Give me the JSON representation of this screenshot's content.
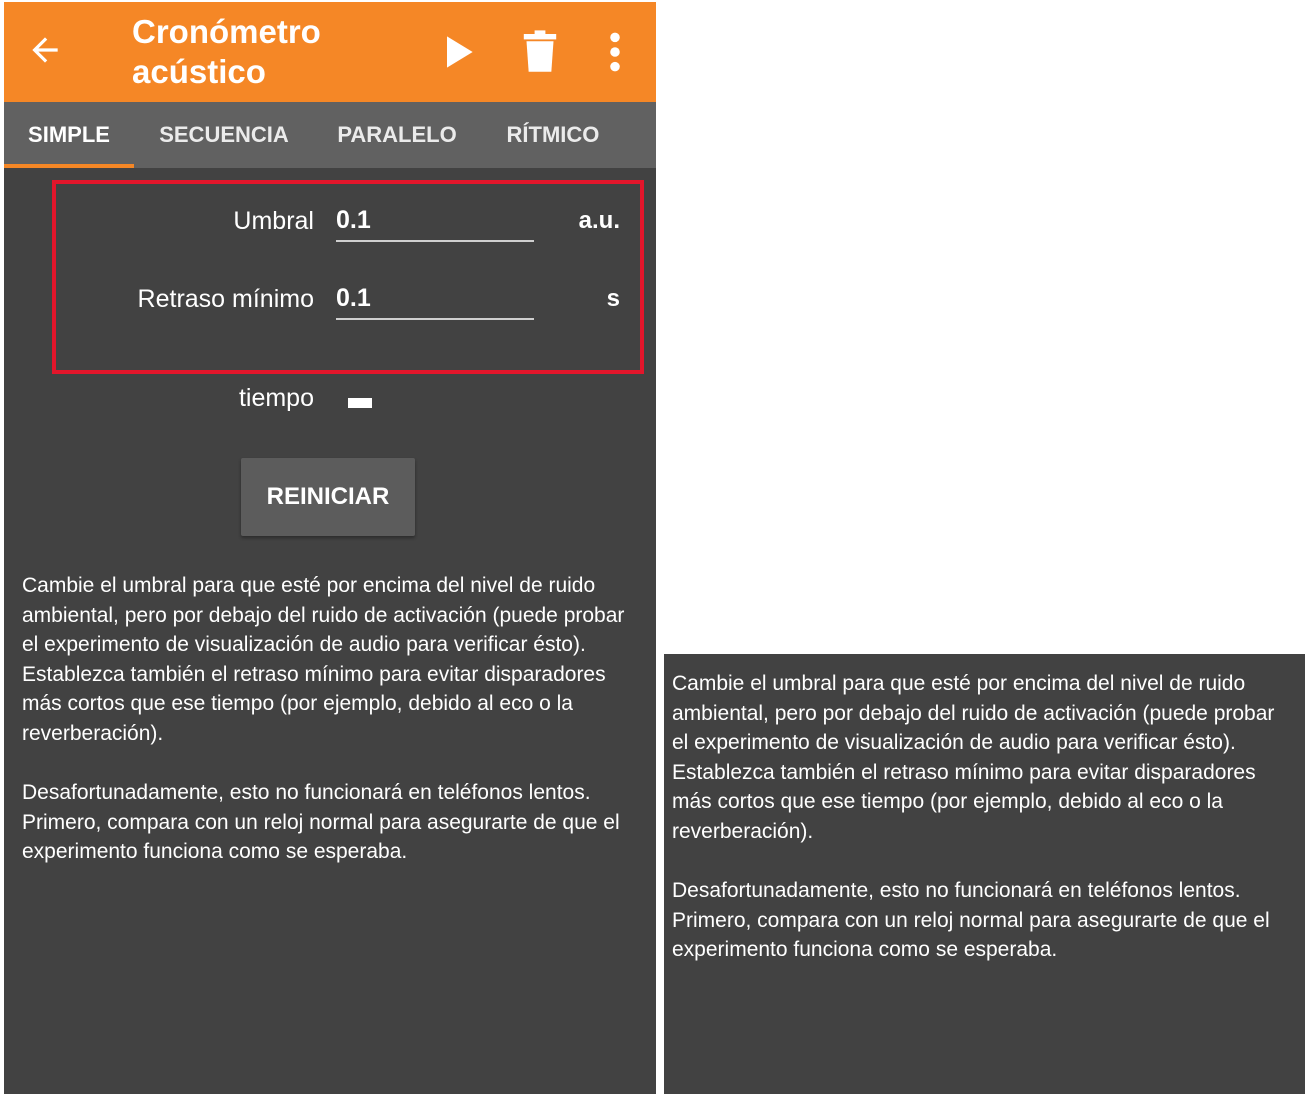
{
  "app_bar": {
    "title": "Cronómetro acústico",
    "back_icon": "arrow-left-icon",
    "play_icon": "play-icon",
    "delete_icon": "trash-icon",
    "more_icon": "more-vert-icon",
    "color": "#f58726"
  },
  "tabs": [
    {
      "label": "SIMPLE",
      "active": true
    },
    {
      "label": "SECUENCIA",
      "active": false
    },
    {
      "label": "PARALELO",
      "active": false
    },
    {
      "label": "RÍTMICO",
      "active": false
    }
  ],
  "fields": {
    "umbral": {
      "label": "Umbral",
      "value": "0.1",
      "unit": "a.u."
    },
    "retraso": {
      "label": "Retraso mínimo",
      "value": "0.1",
      "unit": "s"
    },
    "tiempo": {
      "label": "tiempo",
      "value": "-"
    }
  },
  "reset_button": "REINICIAR",
  "help": {
    "p1": "Cambie el umbral para que esté por encima del nivel de ruido ambiental, pero por debajo del ruido de activación (puede probar el experimento de visualización de audio para verificar ésto). Establezca también el retraso mínimo para evitar disparadores más cortos que ese tiempo (por ejemplo, debido al eco o la reverberación).",
    "p2": "Desafortunadamente, esto no funcionará en teléfonos lentos. Primero, compara con un reloj normal para asegurarte de que el experimento funciona como se esperaba."
  },
  "colors": {
    "background": "#424242",
    "tab_bar": "#616161",
    "highlight": "#e3162b"
  }
}
